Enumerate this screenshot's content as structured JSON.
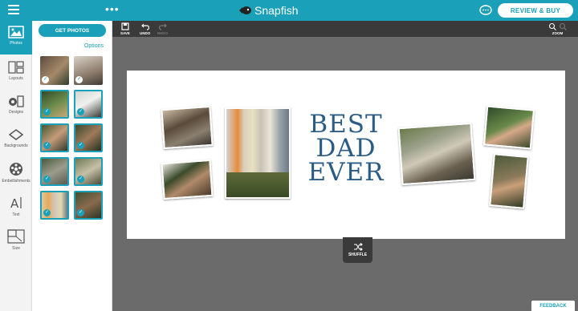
{
  "header": {
    "logo_text": "Snapfish",
    "review_button": "REVIEW & BUY",
    "dots": "•••"
  },
  "rail": {
    "items": [
      {
        "label": "Photos",
        "icon": "photos-icon"
      },
      {
        "label": "Layouts",
        "icon": "layouts-icon"
      },
      {
        "label": "Designs",
        "icon": "designs-icon"
      },
      {
        "label": "Backgrounds",
        "icon": "backgrounds-icon"
      },
      {
        "label": "Embellishments",
        "icon": "embellishments-icon"
      },
      {
        "label": "Text",
        "icon": "text-icon"
      },
      {
        "label": "Size",
        "icon": "size-icon"
      }
    ]
  },
  "panel": {
    "get_photos": "GET PHOTOS",
    "options": "Options"
  },
  "toolbar": {
    "save": "SAVE",
    "undo": "UNDO",
    "redo": "REDO",
    "zoom": "ZOOM"
  },
  "canvas": {
    "title_line1": "BEST",
    "title_line2": "DAD",
    "title_line3": "EVER"
  },
  "shuffle": "SHUFFLE",
  "feedback": "FEEDBACK",
  "colors": {
    "brand": "#1aa0b8",
    "toolbar": "#3a3a3a",
    "workspace": "#6b6b6b"
  }
}
